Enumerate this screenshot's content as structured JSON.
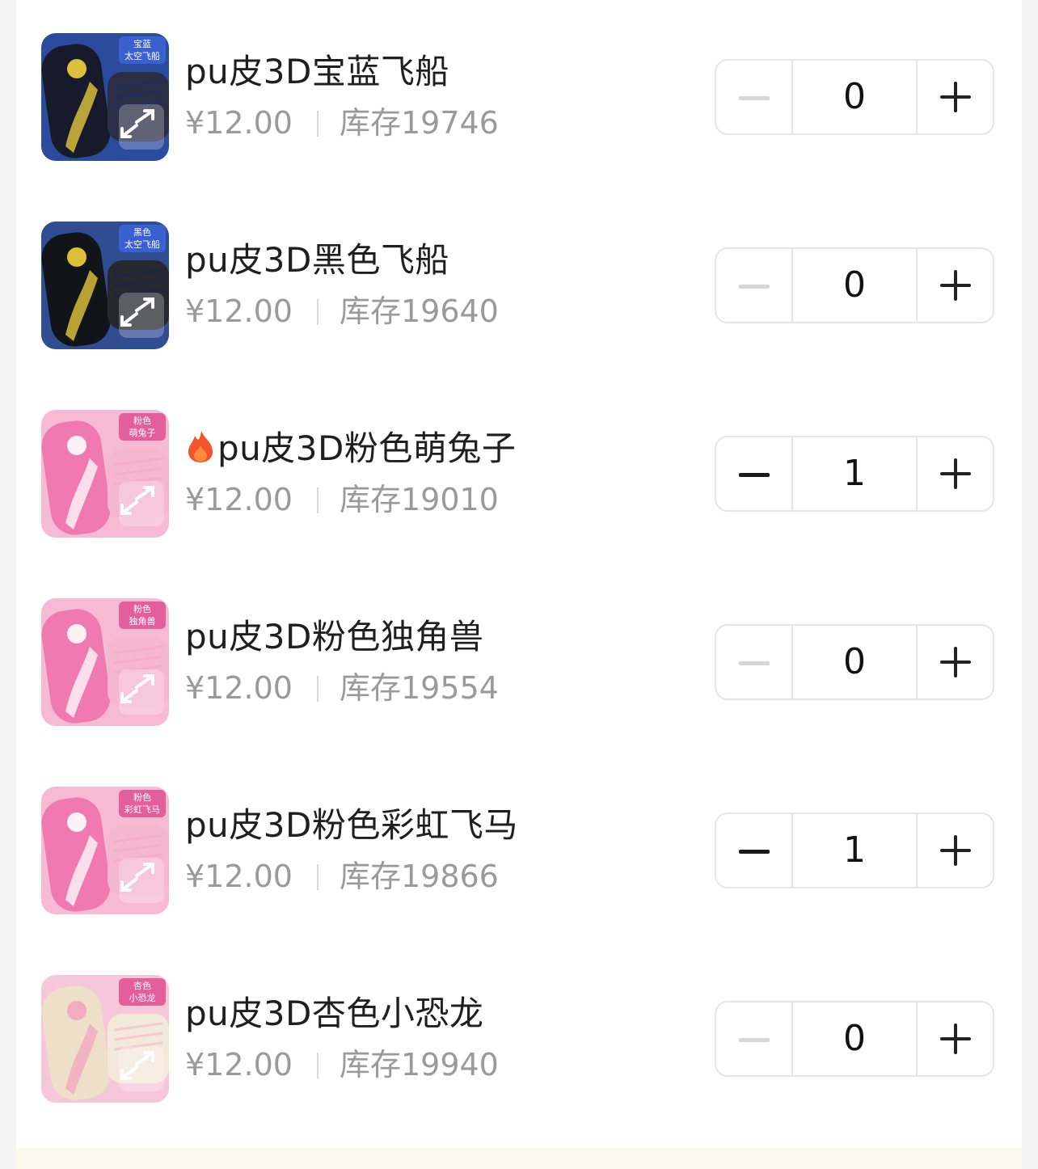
{
  "colors": {
    "minus_active": "#1a1a1a",
    "minus_disabled": "#d6d6d6"
  },
  "items": [
    {
      "title": "pu皮3D宝蓝飞船",
      "hot": false,
      "price": "¥12.00",
      "stock": "库存19746",
      "qty": "0",
      "badge_top": "宝蓝",
      "badge_bottom": "太空飞船",
      "theme": "navy",
      "thumb_icon": "spaceship-pencil-case-icon"
    },
    {
      "title": "pu皮3D黑色飞船",
      "hot": false,
      "price": "¥12.00",
      "stock": "库存19640",
      "qty": "0",
      "badge_top": "黑色",
      "badge_bottom": "太空飞船",
      "theme": "black",
      "thumb_icon": "spaceship-pencil-case-icon"
    },
    {
      "title": "pu皮3D粉色萌兔子",
      "hot": true,
      "price": "¥12.00",
      "stock": "库存19010",
      "qty": "1",
      "badge_top": "粉色",
      "badge_bottom": "萌兔子",
      "theme": "pink",
      "thumb_icon": "bunny-pencil-case-icon"
    },
    {
      "title": "pu皮3D粉色独角兽",
      "hot": false,
      "price": "¥12.00",
      "stock": "库存19554",
      "qty": "0",
      "badge_top": "粉色",
      "badge_bottom": "独角兽",
      "theme": "pink",
      "thumb_icon": "unicorn-pencil-case-icon"
    },
    {
      "title": "pu皮3D粉色彩虹飞马",
      "hot": false,
      "price": "¥12.00",
      "stock": "库存19866",
      "qty": "1",
      "badge_top": "粉色",
      "badge_bottom": "彩虹飞马",
      "theme": "pink",
      "thumb_icon": "pegasus-pencil-case-icon"
    },
    {
      "title": "pu皮3D杏色小恐龙",
      "hot": false,
      "price": "¥12.00",
      "stock": "库存19940",
      "qty": "0",
      "badge_top": "杏色",
      "badge_bottom": "小恐龙",
      "theme": "apricot",
      "thumb_icon": "dinosaur-pencil-case-icon"
    }
  ]
}
